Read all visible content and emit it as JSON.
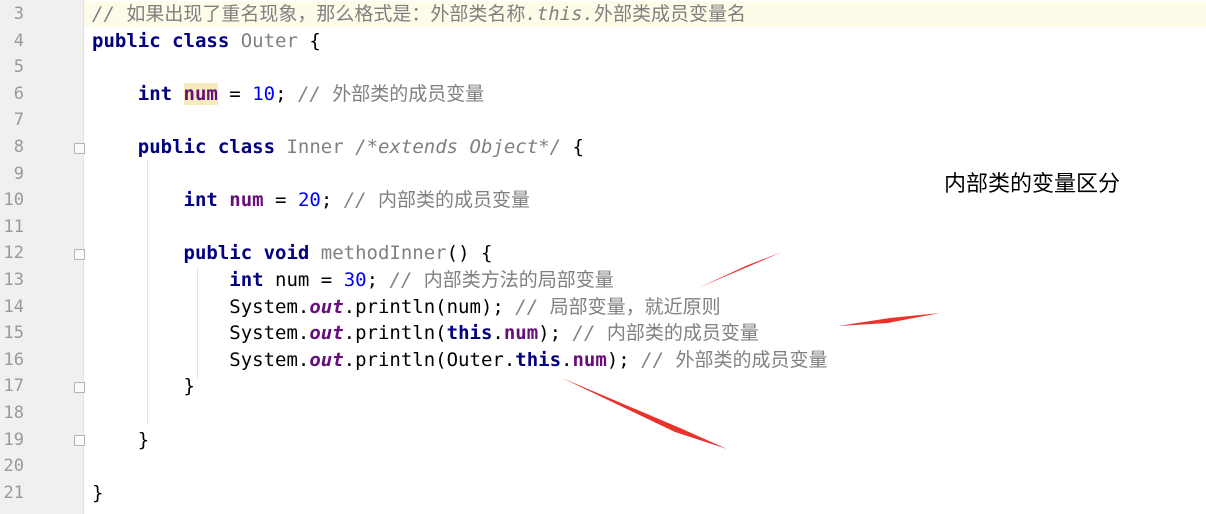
{
  "editor": {
    "lines": [
      {
        "number": "3",
        "parts": [
          {
            "t": "// ",
            "c": "cmt"
          },
          {
            "t": "如果出现了重名现象，那么格式是：外部类名称",
            "c": "cmt-cjk"
          },
          {
            "t": ".this.",
            "c": "cmt"
          },
          {
            "t": "外部类成员变量名",
            "c": "cmt-cjk"
          }
        ]
      },
      {
        "number": "4",
        "parts": [
          {
            "t": "public ",
            "c": "kw"
          },
          {
            "t": "class ",
            "c": "kw"
          },
          {
            "t": "Outer",
            "c": "cls"
          },
          {
            "t": " {",
            "c": ""
          }
        ]
      },
      {
        "number": "5",
        "parts": []
      },
      {
        "number": "6",
        "parts": [
          {
            "t": "    ",
            "c": ""
          },
          {
            "t": "int ",
            "c": "kw"
          },
          {
            "t": "num",
            "c": "fld hl-var"
          },
          {
            "t": " = ",
            "c": ""
          },
          {
            "t": "10",
            "c": "num-lit"
          },
          {
            "t": "; ",
            "c": ""
          },
          {
            "t": "// ",
            "c": "cmt"
          },
          {
            "t": "外部类的成员变量",
            "c": "cmt-cjk"
          }
        ]
      },
      {
        "number": "7",
        "parts": []
      },
      {
        "number": "8",
        "parts": [
          {
            "t": "    ",
            "c": ""
          },
          {
            "t": "public ",
            "c": "kw"
          },
          {
            "t": "class ",
            "c": "kw"
          },
          {
            "t": "Inner",
            "c": "cls"
          },
          {
            "t": " ",
            "c": ""
          },
          {
            "t": "/*extends Object*/",
            "c": "cmt"
          },
          {
            "t": " {",
            "c": ""
          }
        ]
      },
      {
        "number": "9",
        "parts": []
      },
      {
        "number": "10",
        "parts": [
          {
            "t": "        ",
            "c": ""
          },
          {
            "t": "int ",
            "c": "kw"
          },
          {
            "t": "num",
            "c": "fld"
          },
          {
            "t": " = ",
            "c": ""
          },
          {
            "t": "20",
            "c": "num-lit"
          },
          {
            "t": "; ",
            "c": ""
          },
          {
            "t": "// ",
            "c": "cmt"
          },
          {
            "t": "内部类的成员变量",
            "c": "cmt-cjk"
          }
        ]
      },
      {
        "number": "11",
        "parts": []
      },
      {
        "number": "12",
        "parts": [
          {
            "t": "        ",
            "c": ""
          },
          {
            "t": "public ",
            "c": "kw"
          },
          {
            "t": "void ",
            "c": "kw"
          },
          {
            "t": "methodInner",
            "c": "cls"
          },
          {
            "t": "() {",
            "c": ""
          }
        ]
      },
      {
        "number": "13",
        "parts": [
          {
            "t": "            ",
            "c": ""
          },
          {
            "t": "int ",
            "c": "kw"
          },
          {
            "t": "num = ",
            "c": ""
          },
          {
            "t": "30",
            "c": "num-lit"
          },
          {
            "t": "; ",
            "c": ""
          },
          {
            "t": "// ",
            "c": "cmt"
          },
          {
            "t": "内部类方法的局部变量",
            "c": "cmt-cjk"
          }
        ]
      },
      {
        "number": "14",
        "parts": [
          {
            "t": "            System.",
            "c": ""
          },
          {
            "t": "out",
            "c": "static-fld"
          },
          {
            "t": ".println(num); ",
            "c": ""
          },
          {
            "t": "// ",
            "c": "cmt"
          },
          {
            "t": "局部变量，就近原则",
            "c": "cmt-cjk"
          }
        ]
      },
      {
        "number": "15",
        "parts": [
          {
            "t": "            System.",
            "c": ""
          },
          {
            "t": "out",
            "c": "static-fld"
          },
          {
            "t": ".println(",
            "c": ""
          },
          {
            "t": "this",
            "c": "kw"
          },
          {
            "t": ".",
            "c": ""
          },
          {
            "t": "num",
            "c": "fld"
          },
          {
            "t": "); ",
            "c": ""
          },
          {
            "t": "// ",
            "c": "cmt"
          },
          {
            "t": "内部类的成员变量",
            "c": "cmt-cjk"
          }
        ]
      },
      {
        "number": "16",
        "parts": [
          {
            "t": "            System.",
            "c": ""
          },
          {
            "t": "out",
            "c": "static-fld"
          },
          {
            "t": ".println(Outer.",
            "c": ""
          },
          {
            "t": "this",
            "c": "kw"
          },
          {
            "t": ".",
            "c": ""
          },
          {
            "t": "num",
            "c": "fld"
          },
          {
            "t": "); ",
            "c": ""
          },
          {
            "t": "// ",
            "c": "cmt"
          },
          {
            "t": "外部类的成员变量",
            "c": "cmt-cjk"
          }
        ]
      },
      {
        "number": "17",
        "parts": [
          {
            "t": "        }",
            "c": ""
          }
        ]
      },
      {
        "number": "18",
        "parts": []
      },
      {
        "number": "19",
        "parts": [
          {
            "t": "    }",
            "c": ""
          }
        ]
      },
      {
        "number": "20",
        "parts": []
      },
      {
        "number": "21",
        "parts": [
          {
            "t": "}",
            "c": ""
          }
        ]
      }
    ]
  },
  "annotation": {
    "text": "内部类的变量区分"
  },
  "colors": {
    "keyword": "#000080",
    "field": "#660e7a",
    "number": "#0000ff",
    "comment": "#808080",
    "arrow": "#e8322c"
  }
}
